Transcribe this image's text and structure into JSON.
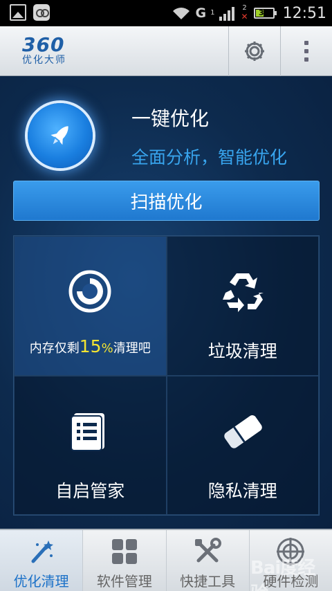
{
  "status_bar": {
    "network_type": "G",
    "sim1_label": "1",
    "sim2_label": "2",
    "battery_level": "32",
    "time": "12:51"
  },
  "header": {
    "logo_number": "360",
    "logo_text": "优化大师",
    "settings_icon": "gear-icon",
    "menu_icon": "more-vertical-icon"
  },
  "hero": {
    "title": "一键优化",
    "subtitle": "全面分析，智能优化",
    "scan_button": "扫描优化"
  },
  "tiles": {
    "memory": {
      "prefix": "内存仅剩",
      "percent": "15",
      "percent_sign": "%",
      "suffix": "清理吧"
    },
    "junk": {
      "label": "垃圾清理"
    },
    "autostart": {
      "label": "自启管家"
    },
    "privacy": {
      "label": "隐私清理"
    }
  },
  "tabs": [
    {
      "label": "优化清理",
      "icon": "magic-wand-icon",
      "active": true
    },
    {
      "label": "软件管理",
      "icon": "apps-grid-icon",
      "active": false
    },
    {
      "label": "快捷工具",
      "icon": "tools-icon",
      "active": false
    },
    {
      "label": "硬件检测",
      "icon": "target-icon",
      "active": false
    }
  ],
  "watermark": "Bai度经验",
  "colors": {
    "accent": "#1d72c8",
    "highlight": "#f4e431",
    "subtitle": "#38a5ee"
  }
}
